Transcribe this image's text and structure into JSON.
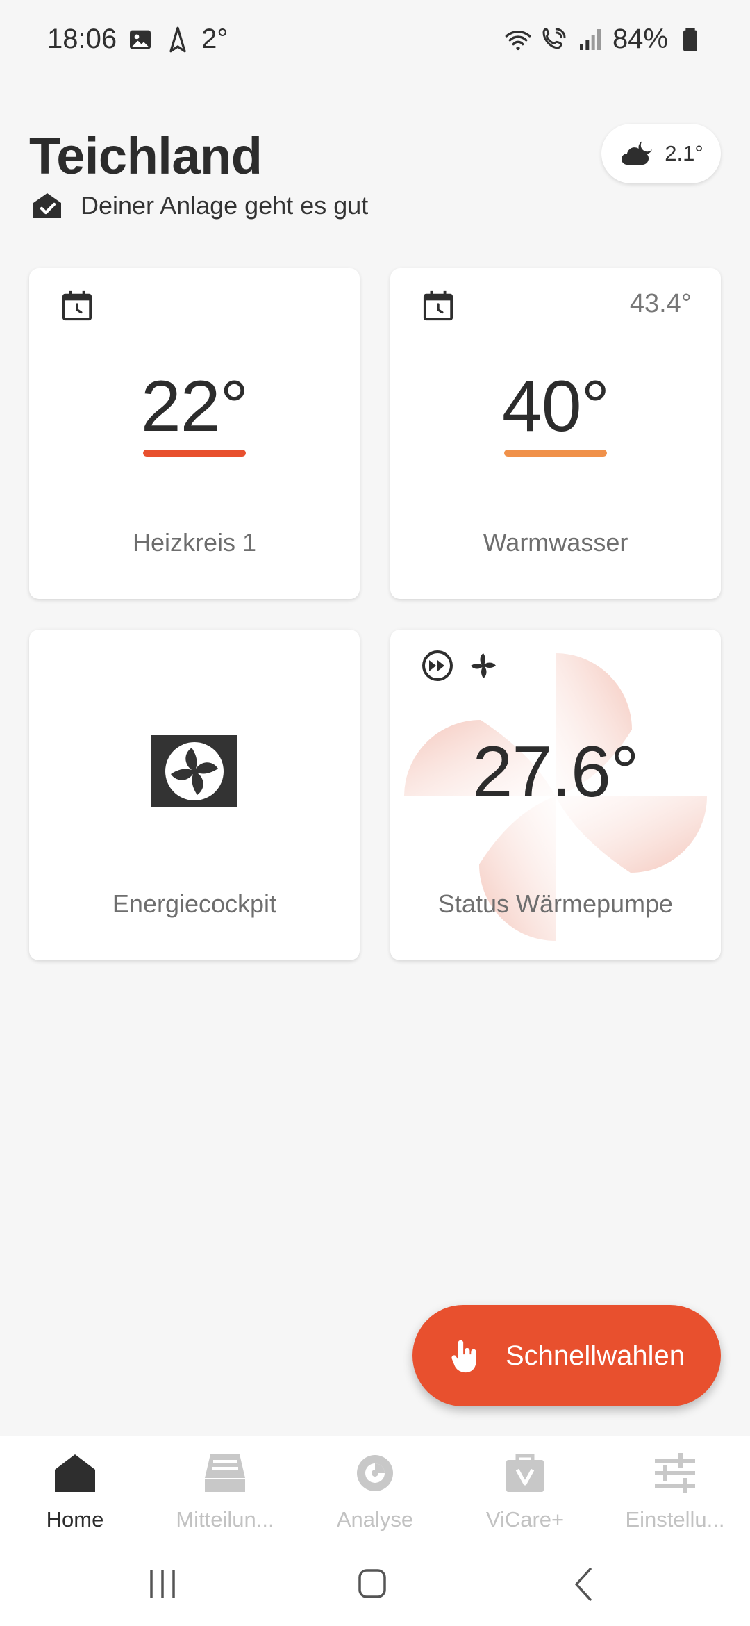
{
  "status_bar": {
    "time": "18:06",
    "weather_temp": "2°",
    "battery": "84%"
  },
  "header": {
    "title": "Teichland",
    "status_text": "Deiner Anlage geht es gut"
  },
  "weather": {
    "temp": "2.1°",
    "icon": "cloud-moon-icon"
  },
  "cards": {
    "heizkreis": {
      "temp": "22°",
      "label": "Heizkreis 1",
      "bar_color": "#e8502e",
      "icon": "calendar-clock-icon"
    },
    "warmwasser": {
      "temp": "40°",
      "label": "Warmwasser",
      "current": "43.4°",
      "bar_color": "#f0914a",
      "icon": "calendar-clock-icon"
    },
    "energiecockpit": {
      "label": "Energiecockpit",
      "icon": "fan-box-icon"
    },
    "waermepumpe": {
      "temp": "27.6°",
      "label": "Status Wärmepumpe",
      "icons": [
        "fast-forward-circle-icon",
        "fan-icon"
      ]
    }
  },
  "fab": {
    "label": "Schnellwahlen",
    "icon": "hand-pointer-icon",
    "color": "#e8502e"
  },
  "bottom_nav": {
    "items": [
      {
        "label": "Home",
        "icon": "house-icon",
        "active": true
      },
      {
        "label": "Mitteilun...",
        "icon": "messages-stack-icon",
        "active": false
      },
      {
        "label": "Analyse",
        "icon": "analysis-icon",
        "active": false
      },
      {
        "label": "ViCare+",
        "icon": "shopping-bag-icon",
        "active": false
      },
      {
        "label": "Einstellu...",
        "icon": "sliders-icon",
        "active": false
      }
    ]
  }
}
